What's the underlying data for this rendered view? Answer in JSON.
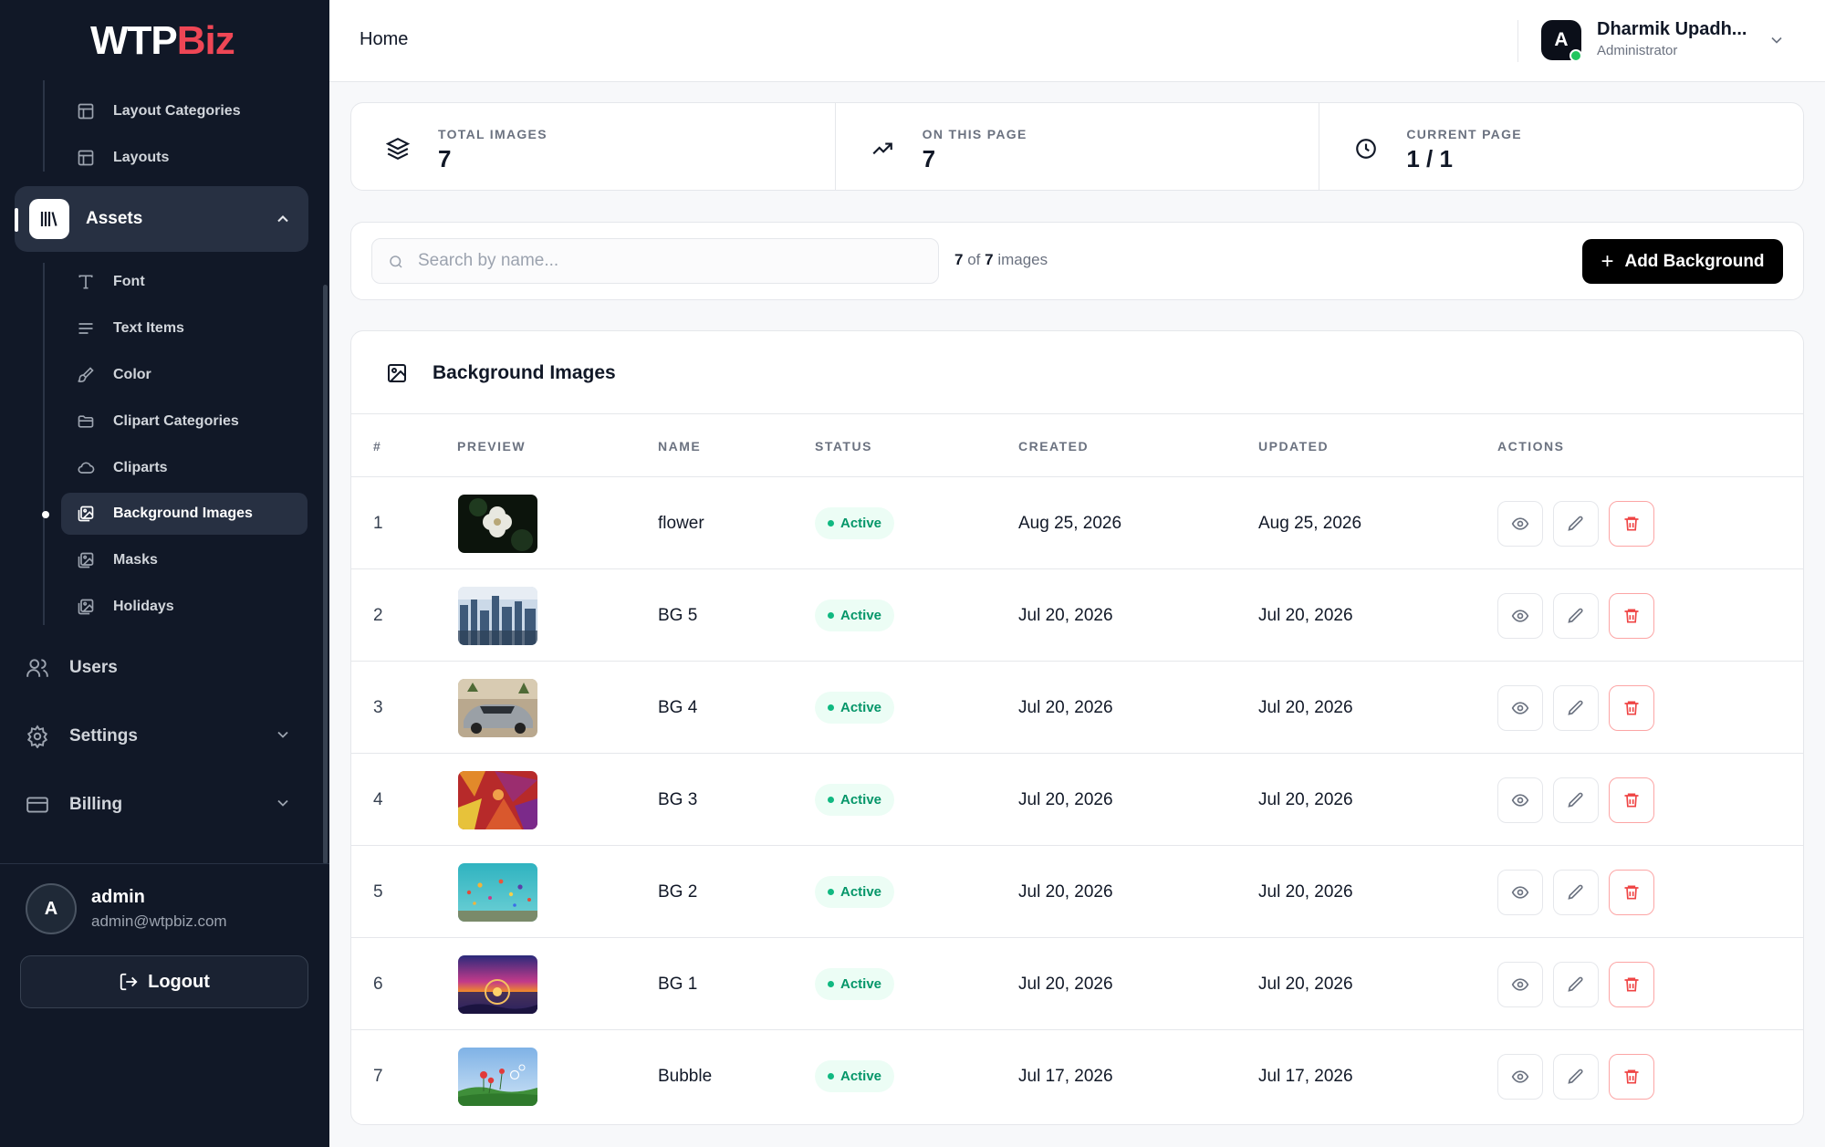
{
  "brand": {
    "logo_part1": "WTP",
    "logo_part2": "Biz"
  },
  "sidebar": {
    "subitems_top": [
      {
        "label": "Layout Categories",
        "icon": "layout-icon"
      },
      {
        "label": "Layouts",
        "icon": "layout-icon"
      }
    ],
    "assets_label": "Assets",
    "asset_items": [
      {
        "label": "Font",
        "icon": "type-icon"
      },
      {
        "label": "Text Items",
        "icon": "text-lines-icon"
      },
      {
        "label": "Color",
        "icon": "paint-brush-icon"
      },
      {
        "label": "Clipart Categories",
        "icon": "folder-icon"
      },
      {
        "label": "Cliparts",
        "icon": "cloud-icon"
      },
      {
        "label": "Background Images",
        "icon": "images-icon",
        "active": true
      },
      {
        "label": "Masks",
        "icon": "images-icon"
      },
      {
        "label": "Holidays",
        "icon": "images-icon"
      }
    ],
    "main_items": [
      {
        "label": "Users",
        "icon": "users-icon"
      },
      {
        "label": "Settings",
        "icon": "gear-icon"
      },
      {
        "label": "Billing",
        "icon": "credit-card-icon"
      }
    ],
    "profile": {
      "initial": "A",
      "name": "admin",
      "email": "admin@wtpbiz.com"
    },
    "logout_label": "Logout"
  },
  "header": {
    "breadcrumb": "Home",
    "user": {
      "initial": "A",
      "name": "Dharmik Upadh...",
      "role": "Administrator"
    }
  },
  "stats": [
    {
      "label": "TOTAL IMAGES",
      "value": "7",
      "icon": "layers-icon"
    },
    {
      "label": "ON THIS PAGE",
      "value": "7",
      "icon": "trending-up-icon"
    },
    {
      "label": "CURRENT PAGE",
      "value": "1 / 1",
      "icon": "clock-icon"
    }
  ],
  "toolbar": {
    "search_placeholder": "Search by name...",
    "count_shown": "7",
    "count_of": "of",
    "count_total": "7",
    "count_suffix": "images",
    "add_label": "Add Background"
  },
  "table": {
    "title": "Background Images",
    "columns": [
      "#",
      "PREVIEW",
      "NAME",
      "STATUS",
      "CREATED",
      "UPDATED",
      "ACTIONS"
    ],
    "rows": [
      {
        "num": "1",
        "name": "flower",
        "status": "Active",
        "created": "Aug 25, 2026",
        "updated": "Aug 25, 2026"
      },
      {
        "num": "2",
        "name": "BG 5",
        "status": "Active",
        "created": "Jul 20, 2026",
        "updated": "Jul 20, 2026"
      },
      {
        "num": "3",
        "name": "BG 4",
        "status": "Active",
        "created": "Jul 20, 2026",
        "updated": "Jul 20, 2026"
      },
      {
        "num": "4",
        "name": "BG 3",
        "status": "Active",
        "created": "Jul 20, 2026",
        "updated": "Jul 20, 2026"
      },
      {
        "num": "5",
        "name": "BG 2",
        "status": "Active",
        "created": "Jul 20, 2026",
        "updated": "Jul 20, 2026"
      },
      {
        "num": "6",
        "name": "BG 1",
        "status": "Active",
        "created": "Jul 20, 2026",
        "updated": "Jul 20, 2026"
      },
      {
        "num": "7",
        "name": "Bubble",
        "status": "Active",
        "created": "Jul 17, 2026",
        "updated": "Jul 17, 2026"
      }
    ]
  },
  "colors": {
    "sidebar_bg": "#111827",
    "brand_red": "#ef4655",
    "active_green": "#059669",
    "danger": "#ef4444"
  }
}
